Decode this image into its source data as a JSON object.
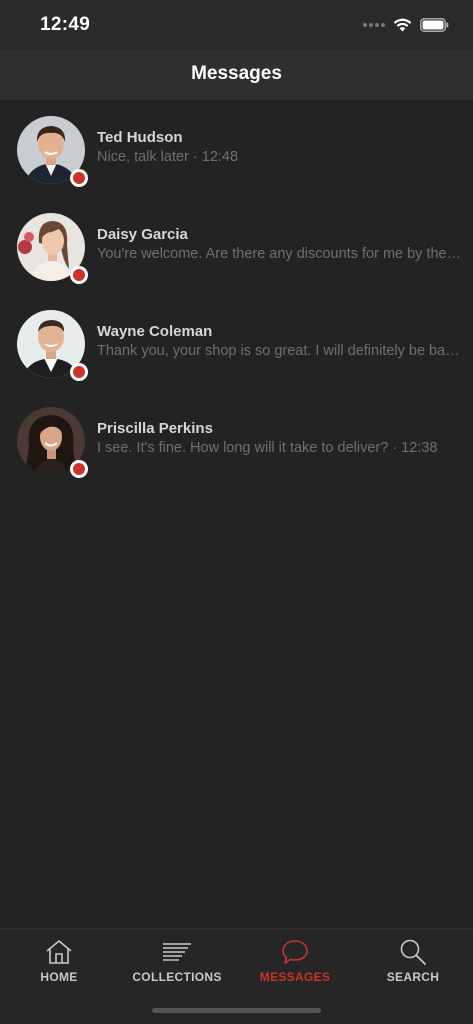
{
  "status_bar": {
    "time": "12:49"
  },
  "header": {
    "title": "Messages"
  },
  "conversations": [
    {
      "name": "Ted Hudson",
      "preview": "Nice, talk later · 12:48",
      "avatar": "avatar-ted-hudson"
    },
    {
      "name": "Daisy Garcia",
      "preview": "You're welcome. Are there any discounts for me by the end of the week?",
      "avatar": "avatar-daisy-garcia"
    },
    {
      "name": "Wayne Coleman",
      "preview": "Thank you, your shop is so great. I will definitely be back again soon!",
      "avatar": "avatar-wayne-coleman"
    },
    {
      "name": "Priscilla Perkins",
      "preview": "I see. It's fine. How long will it take to deliver? · 12:38",
      "avatar": "avatar-priscilla-perkins"
    }
  ],
  "tabbar": {
    "items": [
      {
        "label": "HOME",
        "icon": "home-icon"
      },
      {
        "label": "COLLECTIONS",
        "icon": "collections-icon"
      },
      {
        "label": "MESSAGES",
        "icon": "chat-bubble-icon",
        "active": true
      },
      {
        "label": "SEARCH",
        "icon": "search-icon"
      }
    ]
  },
  "colors": {
    "accent": "#c9332c",
    "background": "#232323",
    "header": "#2f2f2f",
    "presence": "#c9332c"
  }
}
